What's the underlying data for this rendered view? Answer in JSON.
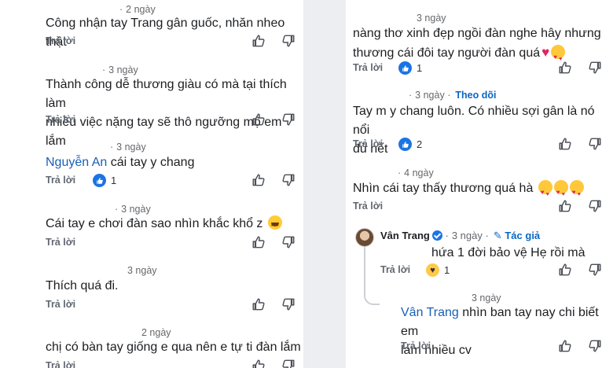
{
  "ui": {
    "reply_label": "Trả lời",
    "follow_label": "Theo dõi",
    "author_label": "Tác giả",
    "dot": "·"
  },
  "left_comments": [
    {
      "time": "2 ngày",
      "text": "Công nhận tay Trang gân guốc, nhăn nheo thật"
    },
    {
      "time": "3 ngày",
      "text_line1": "Thành công dễ thương giàu có mà tại thích làm",
      "text_line2": "nhiều việc nặng tay sẽ thô ngưỡng mộ em lắm"
    },
    {
      "time": "3 ngày",
      "mention": "Nguyễn An",
      "text": "cái tay y chang",
      "reactions": "1"
    },
    {
      "time": "3 ngày",
      "text": "Cái tay e chơi đàn sao nhìn khắc khổ z",
      "emoji": "grinning-face"
    },
    {
      "time": "3 ngày",
      "text": "Thích quá đi."
    },
    {
      "time": "2 ngày",
      "text": "chị có bàn tay giống e qua nên e tự ti đàn lắm"
    }
  ],
  "right_comments": [
    {
      "time": "3 ngày",
      "text_line1": "nàng thơ xinh đẹp ngồi đàn nghe hây nhưng",
      "text_line2": "thương cái đôi tay người đàn quá",
      "emoji": [
        "red-heart",
        "smiling-face-with-hearts"
      ],
      "reactions": "1"
    },
    {
      "time": "3 ngày",
      "text_line1": "Tay m y chang luôn. Có nhiều sợi gân là nó nổi",
      "text_line2": "đủ hết",
      "reactions": "2"
    },
    {
      "time": "4 ngày",
      "text": "Nhìn cái tay thấy thương quá hà",
      "emoji": [
        "smiling-face-with-hearts",
        "smiling-face-with-hearts",
        "smiling-face-with-hearts"
      ]
    },
    {
      "author": "Vân Trang",
      "time": "3 ngày",
      "text": "hứa 1 đời bảo vệ Hẹ rồi mà",
      "reactions": "1",
      "reaction_type": "care"
    },
    {
      "time": "3 ngày",
      "mention": "Vân Trang",
      "text_line1": "nhìn ban tay nay chi biết em",
      "text_line2": "lam nhiều cv"
    }
  ]
}
